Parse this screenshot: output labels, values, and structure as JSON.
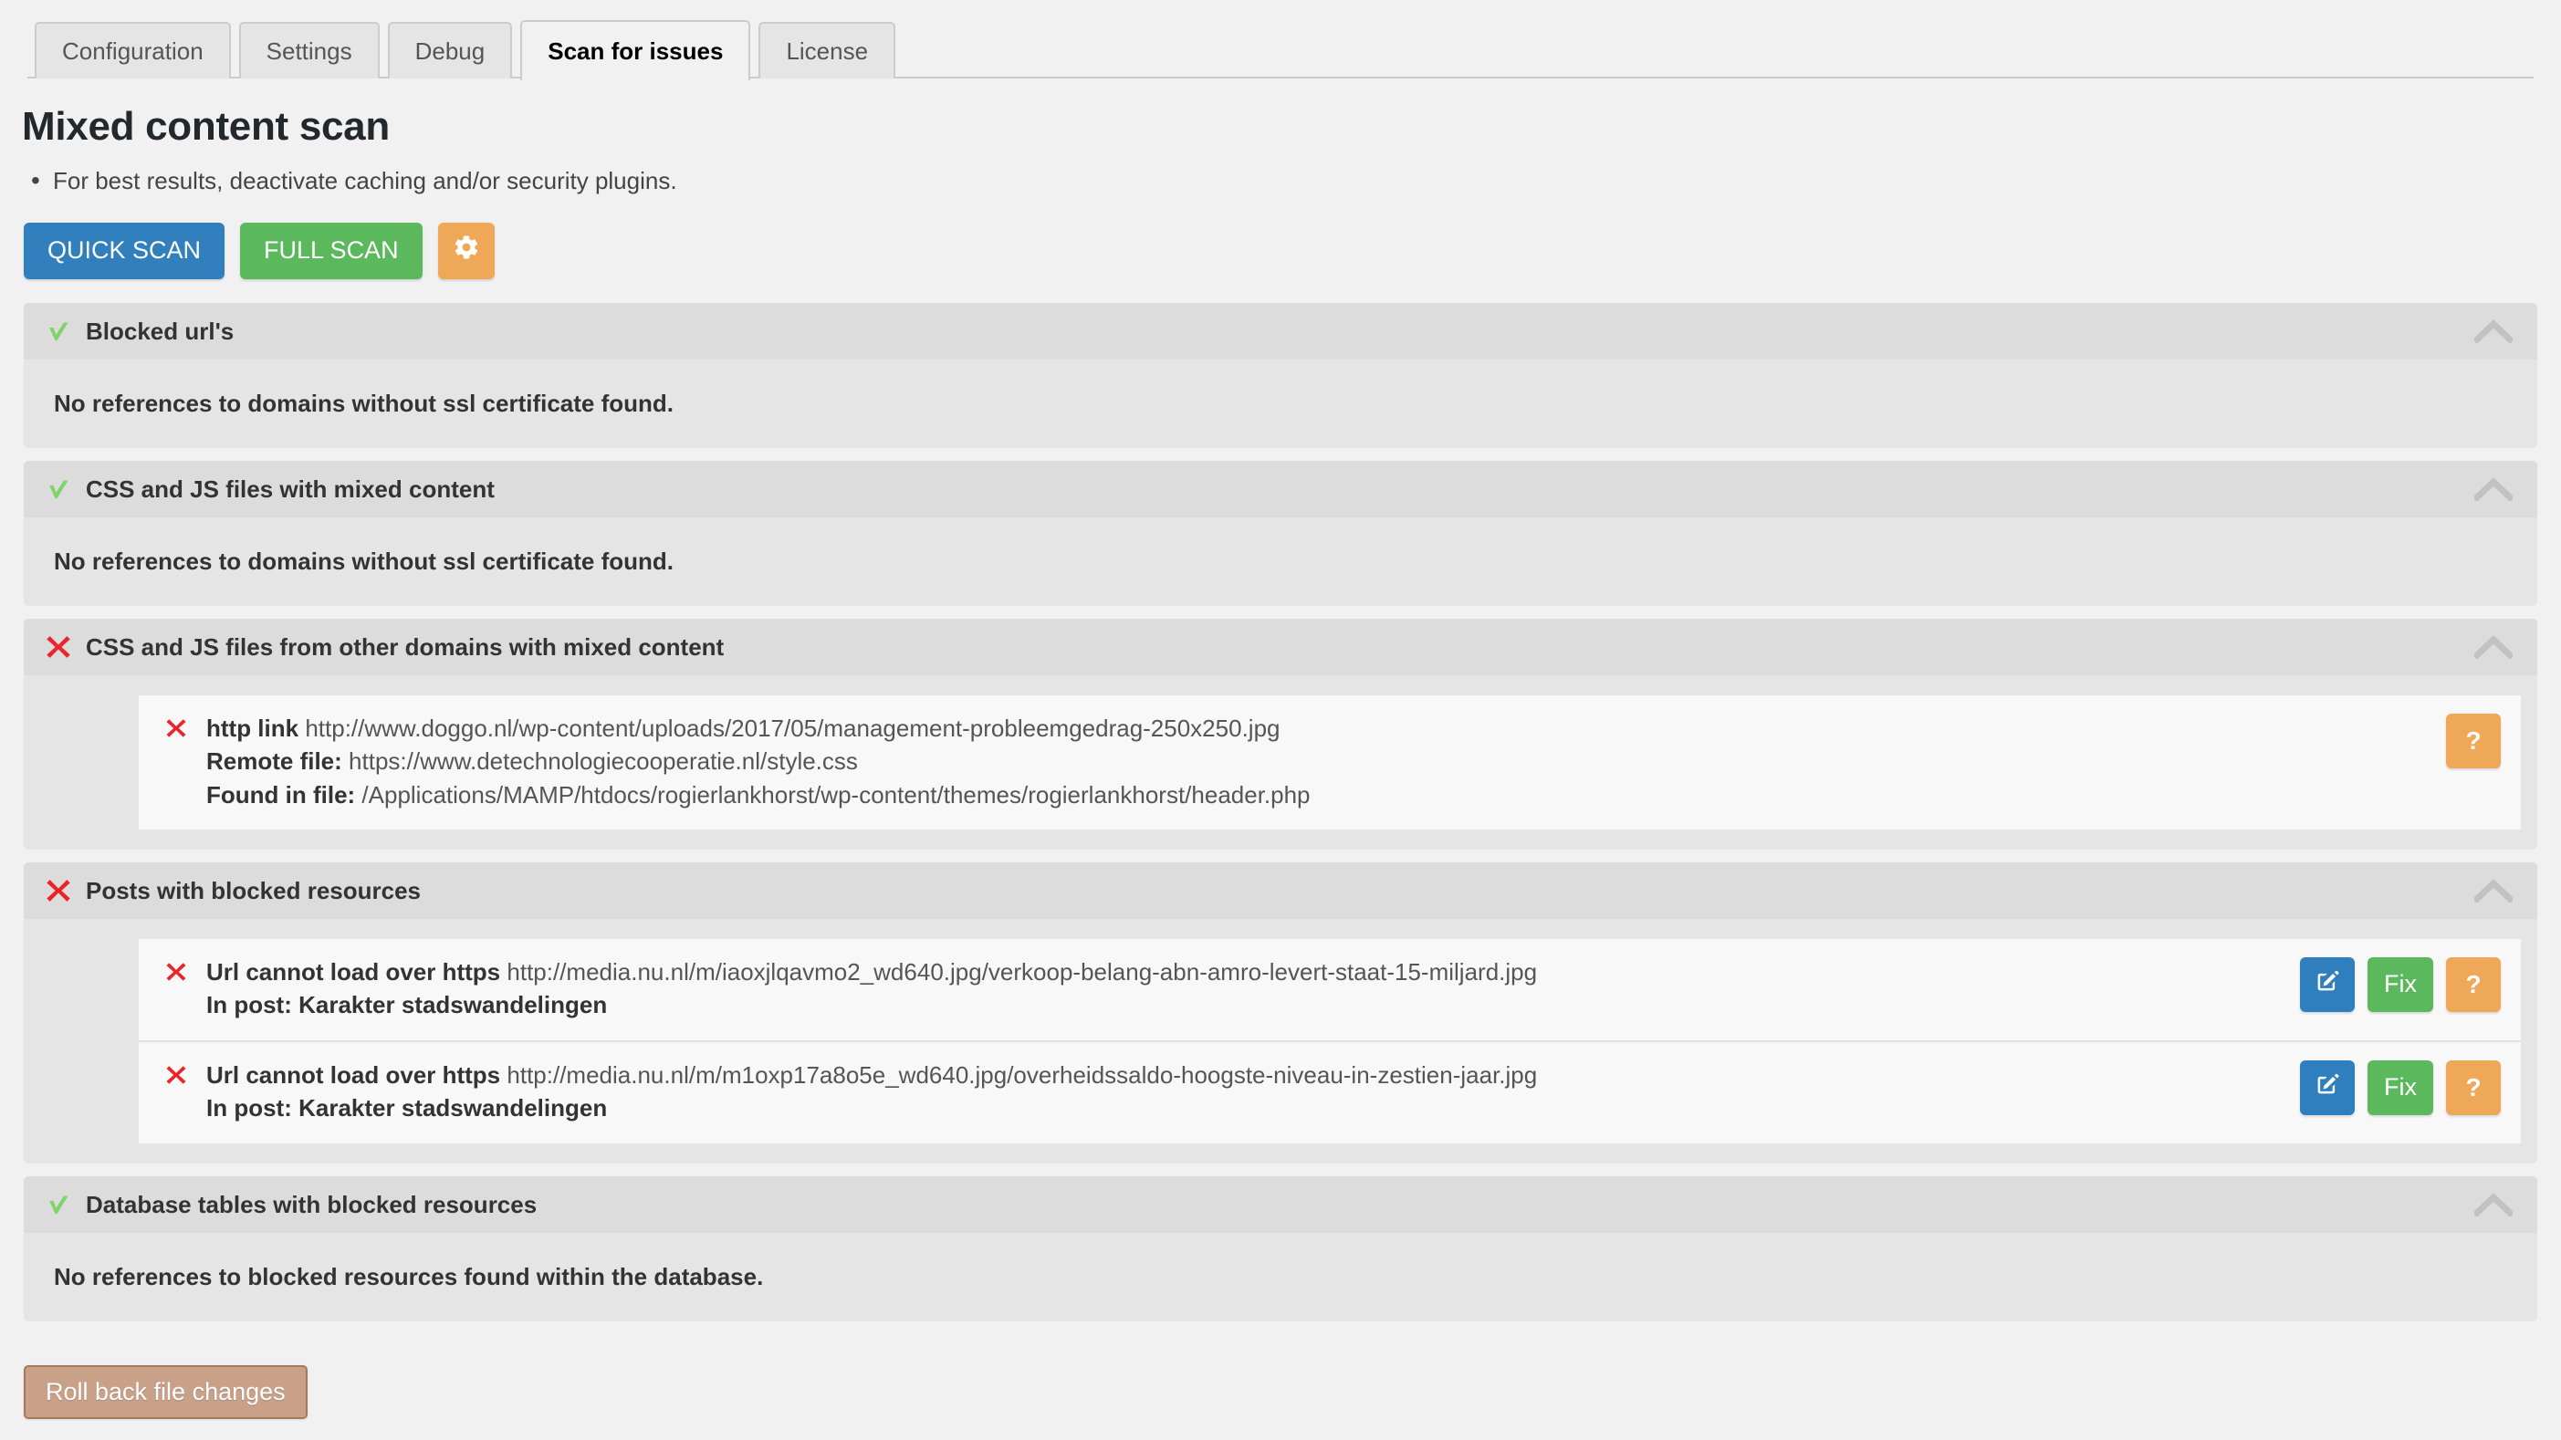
{
  "tabs": [
    {
      "label": "Configuration",
      "active": false
    },
    {
      "label": "Settings",
      "active": false
    },
    {
      "label": "Debug",
      "active": false
    },
    {
      "label": "Scan for issues",
      "active": true
    },
    {
      "label": "License",
      "active": false
    }
  ],
  "header": {
    "title": "Mixed content scan",
    "notes": [
      "For best results, deactivate caching and/or security plugins."
    ]
  },
  "actions": {
    "quick_scan": "QUICK SCAN",
    "full_scan": "FULL SCAN",
    "settings_icon": "gear-icon"
  },
  "colors": {
    "blue": "#3180bd",
    "green": "#5cb85c",
    "orange": "#efa857",
    "red": "#e8252a",
    "green_check": "#7fd36b",
    "rollback": "#c9a189",
    "panel_header": "#dcdcdc",
    "panel_body": "#e5e5e5",
    "page_bg": "#f1f1f1"
  },
  "panels": [
    {
      "status": "ok",
      "title": "Blocked url's",
      "collapse_icon": "chevron-up-icon",
      "empty_message": "No references to domains without ssl certificate found.",
      "rows": []
    },
    {
      "status": "ok",
      "title": "CSS and JS files with mixed content",
      "collapse_icon": "chevron-up-icon",
      "empty_message": "No references to domains without ssl certificate found.",
      "rows": []
    },
    {
      "status": "error",
      "title": "CSS and JS files from other domains with mixed content",
      "collapse_icon": "chevron-up-icon",
      "empty_message": "",
      "rows": [
        {
          "lines": [
            {
              "label": "http link",
              "value": "http://www.doggo.nl/wp-content/uploads/2017/05/management-probleemgedrag-250x250.jpg"
            },
            {
              "label": "Remote file:",
              "value": "https://www.detechnologiecooperatie.nl/style.css"
            },
            {
              "label": "Found in file:",
              "value": "/Applications/MAMP/htdocs/rogierlankhorst/wp-content/themes/rogierlankhorst/header.php"
            }
          ],
          "buttons": [
            {
              "type": "help",
              "label": "?"
            }
          ]
        }
      ]
    },
    {
      "status": "error",
      "title": "Posts with blocked resources",
      "collapse_icon": "chevron-up-icon",
      "empty_message": "",
      "rows": [
        {
          "lines": [
            {
              "label": "Url cannot load over https",
              "value": "http://media.nu.nl/m/iaoxjlqavmo2_wd640.jpg/verkoop-belang-abn-amro-levert-staat-15-miljard.jpg"
            },
            {
              "label": "In post: Karakter stadswandelingen",
              "value": ""
            }
          ],
          "buttons": [
            {
              "type": "edit",
              "label": "edit-icon"
            },
            {
              "type": "fix",
              "label": "Fix"
            },
            {
              "type": "help",
              "label": "?"
            }
          ]
        },
        {
          "lines": [
            {
              "label": "Url cannot load over https",
              "value": "http://media.nu.nl/m/m1oxp17a8o5e_wd640.jpg/overheidssaldo-hoogste-niveau-in-zestien-jaar.jpg"
            },
            {
              "label": "In post: Karakter stadswandelingen",
              "value": ""
            }
          ],
          "buttons": [
            {
              "type": "edit",
              "label": "edit-icon"
            },
            {
              "type": "fix",
              "label": "Fix"
            },
            {
              "type": "help",
              "label": "?"
            }
          ]
        }
      ]
    },
    {
      "status": "ok",
      "title": "Database tables with blocked resources",
      "collapse_icon": "chevron-up-icon",
      "empty_message": "No references to blocked resources found within the database.",
      "rows": []
    }
  ],
  "footer": {
    "rollback_label": "Roll back file changes"
  }
}
